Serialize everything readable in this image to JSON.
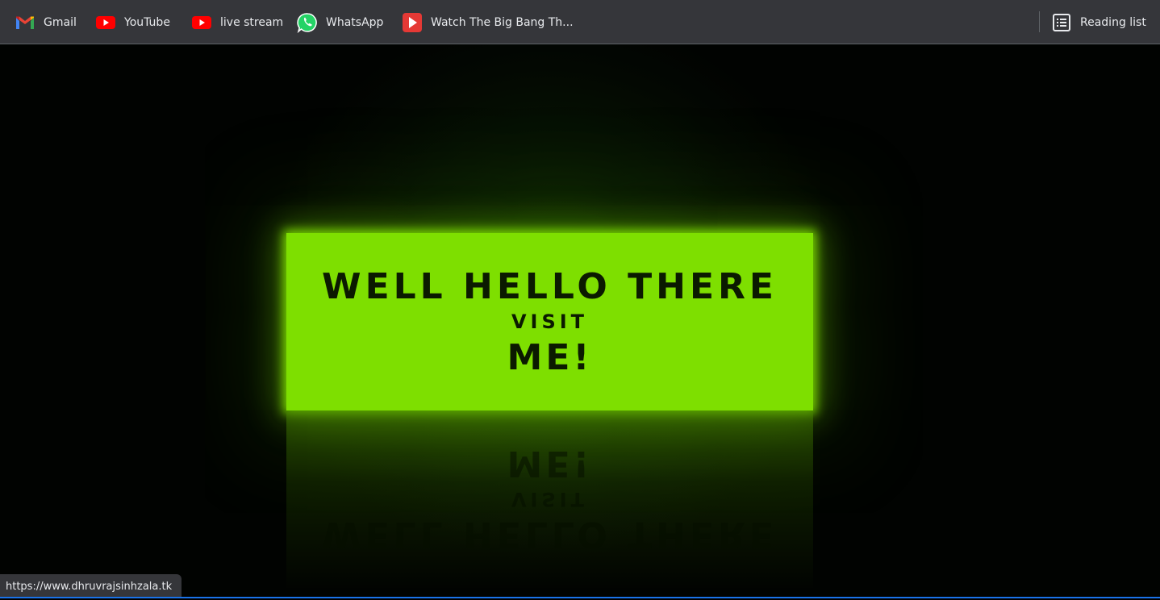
{
  "bookmarks": [
    {
      "label": "Gmail",
      "icon": "gmail-icon"
    },
    {
      "label": "YouTube",
      "icon": "youtube-icon"
    },
    {
      "label": "live stream",
      "icon": "youtube-icon"
    },
    {
      "label": "WhatsApp",
      "icon": "whatsapp-icon"
    },
    {
      "label": "Watch The Big Bang Th...",
      "icon": "play-icon"
    }
  ],
  "reading_list": {
    "label": "Reading list",
    "icon": "reading-list-icon"
  },
  "hero": {
    "line1": "WELL HELLO THERE",
    "line2": "VISIT",
    "line3": "ME!"
  },
  "status_url": "https://www.dhruvrajsinhzala.tk",
  "colors": {
    "neon_green": "#7edf00",
    "toolbar_bg": "#35363a",
    "page_bg": "#000000"
  }
}
